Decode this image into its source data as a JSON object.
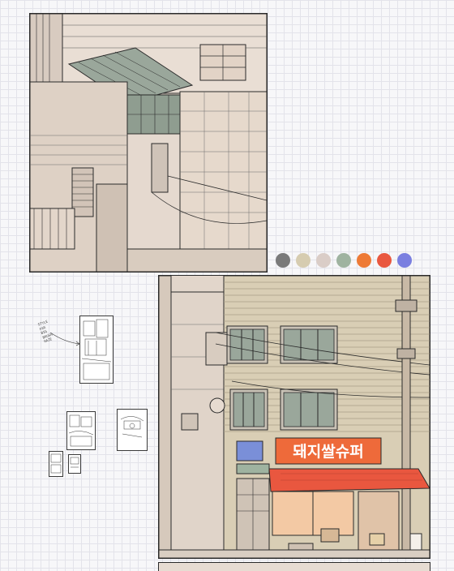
{
  "palette": {
    "swatches": [
      "#7a7a7a",
      "#d6ccb0",
      "#dacdc7",
      "#9fb3a0",
      "#ee7a36",
      "#e9573f",
      "#7a7fe0"
    ]
  },
  "sketch_note": [
    "STYLE",
    "FAR",
    "BIG",
    "BRUSH",
    "HAZE"
  ],
  "storefront": {
    "sign_text": "돼지쌀슈퍼",
    "sign_color": "#ee6a3a",
    "awning_color": "#e9573f"
  },
  "colors": {
    "building": "#e7dcd2",
    "siding": "#d9ceb5",
    "window_glass": "#9aa79b",
    "outline": "#2a2a2a"
  }
}
